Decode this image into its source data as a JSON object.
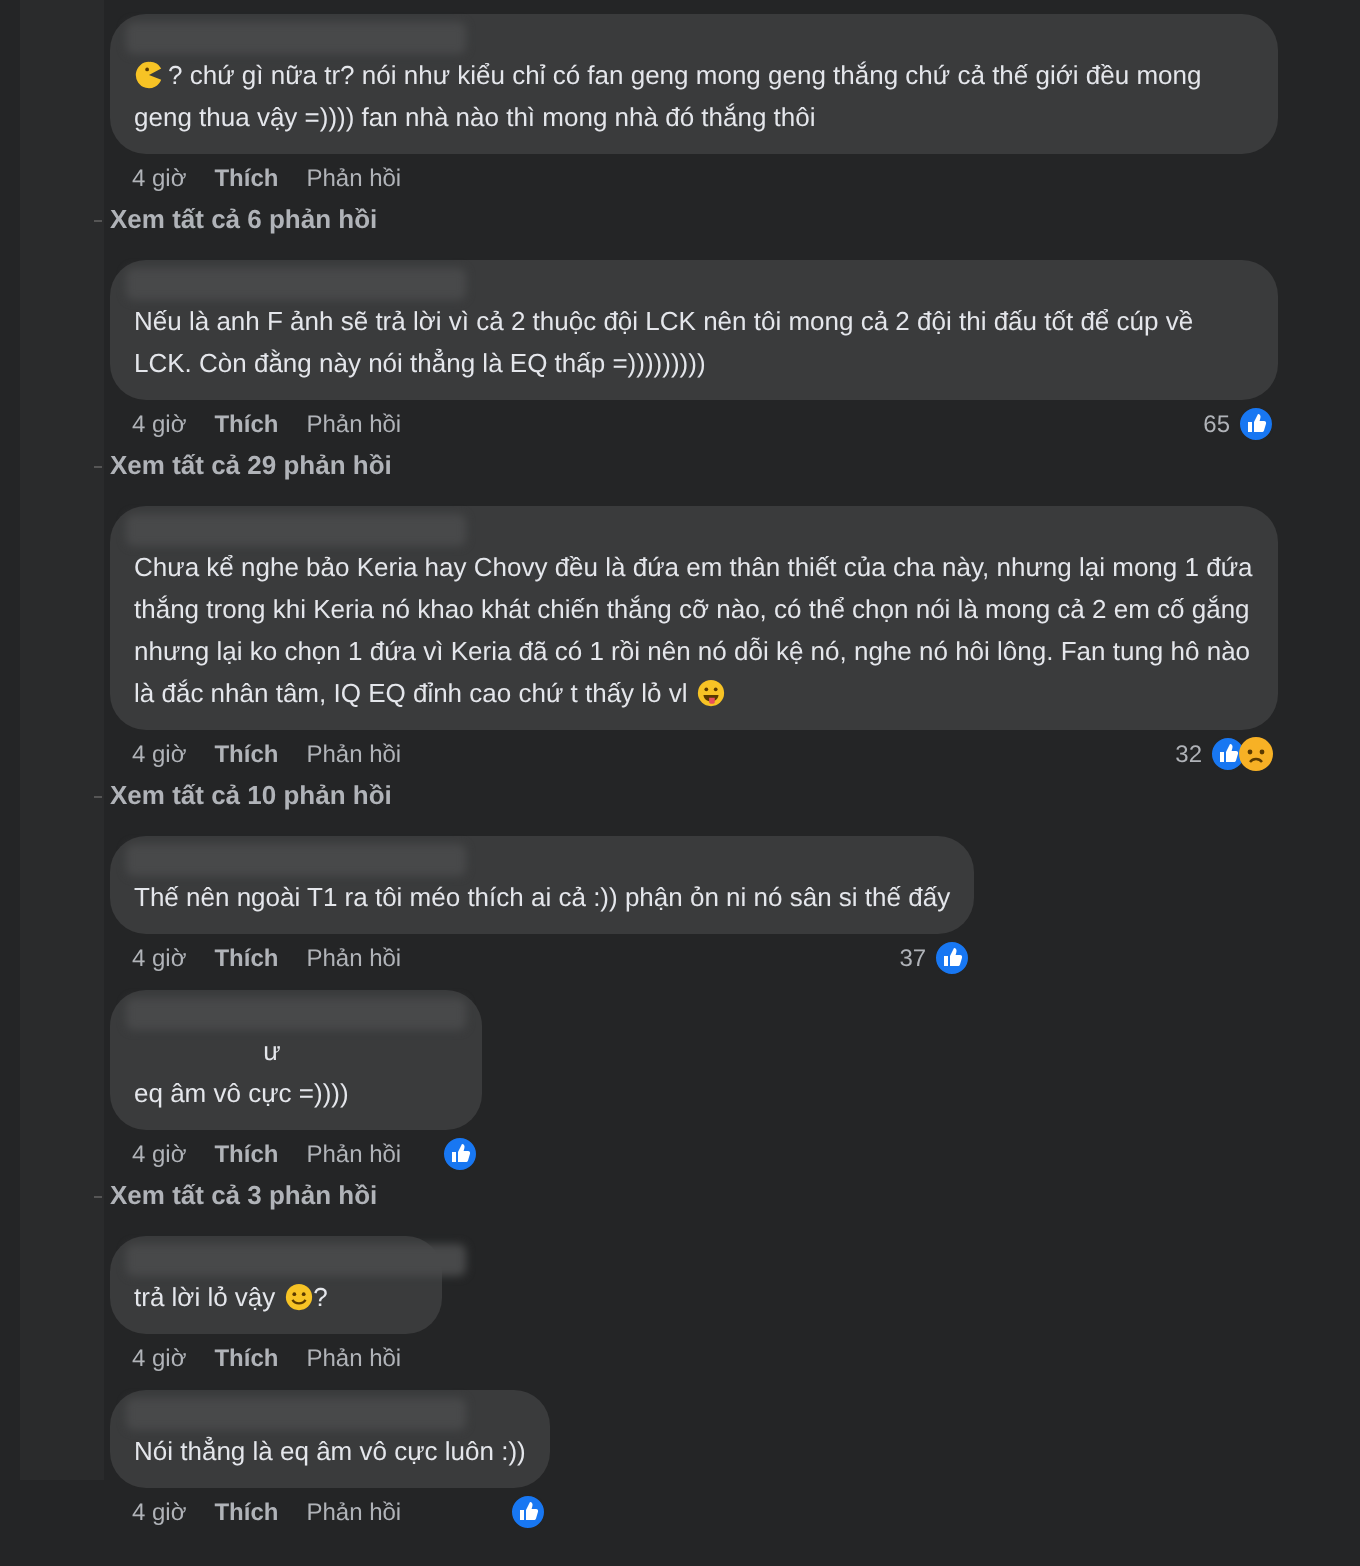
{
  "comments": [
    {
      "lead_emoji": {
        "kind": "pacman"
      },
      "lines": [
        "? chứ gì nữa tr? nói như kiểu chỉ có fan geng mong geng thắng chứ cả thế giới đều mong geng thua vậy =)))) fan nhà nào thì mong nhà đó thắng thôi"
      ],
      "time": "4 giờ",
      "like": "Thích",
      "reply": "Phản hồi",
      "view_replies": "Xem tất cả 6 phản hồi"
    },
    {
      "lines": [
        "Nếu là anh F ảnh sẽ trả lời vì cả 2 thuộc đội LCK nên tôi mong cả 2 đội thi đấu tốt để cúp về LCK. Còn đằng này nói thẳng là EQ thấp =)))))))))"
      ],
      "time": "4 giờ",
      "like": "Thích",
      "reply": "Phản hồi",
      "count": "65",
      "reactions": [
        {
          "kind": "like"
        }
      ],
      "view_replies": "Xem tất cả 29 phản hồi"
    },
    {
      "lines": [
        "Chưa kể nghe bảo Keria hay Chovy đều là đứa em thân thiết của cha này, nhưng lại mong 1 đứa thắng trong khi Keria nó khao khát chiến thắng cỡ nào, có thể chọn nói là mong cả 2 em cố gắng nhưng lại ko chọn 1 đứa vì Keria đã có 1 rồi nên nó dỗi kệ nó, nghe nó hôi lông. Fan tung hô nào là đắc nhân tâm, IQ EQ đỉnh cao chứ t thấy lỏ vl"
      ],
      "trail_emoji": {
        "kind": "tongue"
      },
      "time": "4 giờ",
      "like": "Thích",
      "reply": "Phản hồi",
      "count": "32",
      "reactions": [
        {
          "kind": "like"
        },
        {
          "kind": "sad"
        }
      ],
      "view_replies": "Xem tất cả 10 phản hồi"
    },
    {
      "lines": [
        "Thế nên ngoài T1 ra tôi méo thích ai cả :)) phận ỏn ni nó sân si thế đấy"
      ],
      "time": "4 giờ",
      "like": "Thích",
      "reply": "Phản hồi",
      "count": "37",
      "reactions": [
        {
          "kind": "like"
        }
      ]
    },
    {
      "lines": [
        "ư",
        "eq âm vô cực =))))"
      ],
      "time": "4 giờ",
      "like": "Thích",
      "reply": "Phản hồi",
      "reactions": [
        {
          "kind": "like"
        }
      ],
      "view_replies": "Xem tất cả 3 phản hồi"
    },
    {
      "lines": [
        "trả lời lỏ vậy"
      ],
      "trail_emoji": {
        "kind": "smile"
      },
      "trail_text": "?",
      "time": "4 giờ",
      "like": "Thích",
      "reply": "Phản hồi"
    },
    {
      "lines": [
        "Nói thẳng là eq âm vô cực luôn :))"
      ],
      "time": "4 giờ",
      "like": "Thích",
      "reply": "Phản hồi",
      "reactions": [
        {
          "kind": "like"
        }
      ]
    }
  ]
}
